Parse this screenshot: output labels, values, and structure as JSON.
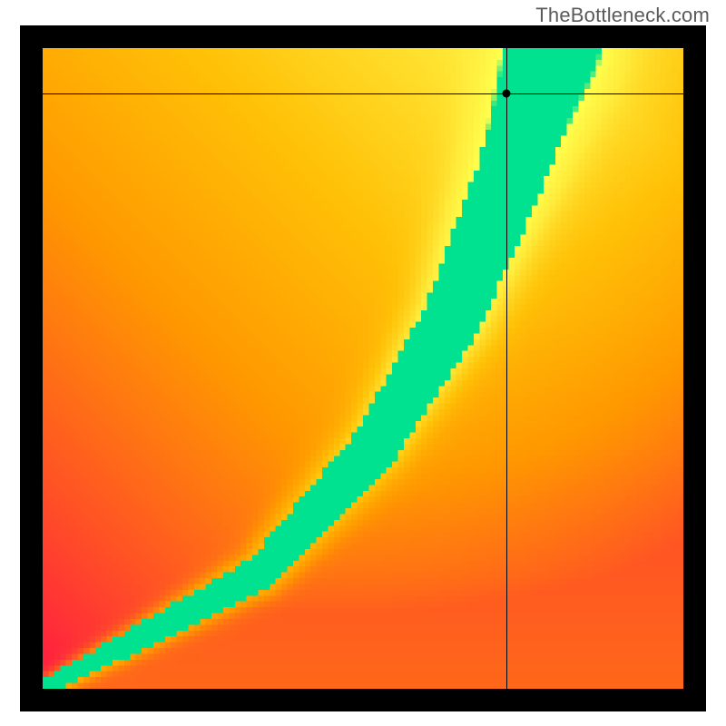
{
  "watermark": "TheBottleneck.com",
  "chart_data": {
    "type": "heatmap",
    "title": "",
    "xlabel": "",
    "ylabel": "",
    "xlim": [
      0,
      1
    ],
    "ylim": [
      0,
      1
    ],
    "grid": false,
    "colorscale": [
      {
        "t": 0.0,
        "hex": "#ff1744"
      },
      {
        "t": 0.2,
        "hex": "#ff5722"
      },
      {
        "t": 0.4,
        "hex": "#ff9800"
      },
      {
        "t": 0.6,
        "hex": "#ffc107"
      },
      {
        "t": 0.8,
        "hex": "#ffeb3b"
      },
      {
        "t": 0.97,
        "hex": "#ffff4d"
      },
      {
        "t": 1.0,
        "hex": "#00e28f"
      }
    ],
    "ridge_vertices": [
      {
        "x": 0.0,
        "y": 0.0
      },
      {
        "x": 0.34,
        "y": 0.18
      },
      {
        "x": 0.52,
        "y": 0.38
      },
      {
        "x": 0.64,
        "y": 0.58
      },
      {
        "x": 0.73,
        "y": 0.8
      },
      {
        "x": 0.8,
        "y": 1.0
      }
    ],
    "ridge_half_width_norm": 0.04,
    "background_falloff_scale": 0.9,
    "resolution": 110,
    "crosshair": {
      "x": 0.724,
      "y": 0.929
    },
    "marker": {
      "x": 0.724,
      "y": 0.929
    }
  }
}
